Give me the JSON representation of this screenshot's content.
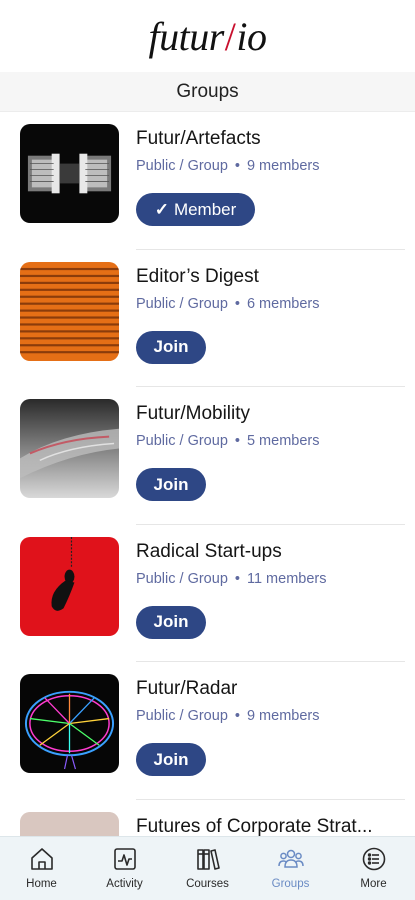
{
  "header": {
    "logo_left": "futur",
    "logo_slash": "/",
    "logo_right": "io",
    "title": "Groups"
  },
  "groups": [
    {
      "name": "Futur/Artefacts",
      "visibility": "Public / Group",
      "members": "9 members",
      "action": "Member",
      "check": "✓"
    },
    {
      "name": "Editor’s Digest",
      "visibility": "Public / Group",
      "members": "6 members",
      "action": "Join"
    },
    {
      "name": "Futur/Mobility",
      "visibility": "Public / Group",
      "members": "5 members",
      "action": "Join"
    },
    {
      "name": "Radical Start-ups",
      "visibility": "Public / Group",
      "members": "11 members",
      "action": "Join"
    },
    {
      "name": "Futur/Radar",
      "visibility": "Public / Group",
      "members": "9 members",
      "action": "Join"
    },
    {
      "name": "Futures of Corporate Strat..."
    }
  ],
  "separator": "•",
  "tabs": [
    {
      "label": "Home",
      "icon": "home-icon"
    },
    {
      "label": "Activity",
      "icon": "activity-icon"
    },
    {
      "label": "Courses",
      "icon": "courses-icon"
    },
    {
      "label": "Groups",
      "icon": "groups-icon",
      "active": true
    },
    {
      "label": "More",
      "icon": "more-icon"
    }
  ],
  "colors": {
    "button": "#2e4785",
    "meta_text": "#5f6aa0",
    "active_tab": "#6a8bc4",
    "logo_slash": "#c8102e",
    "tabbar_bg": "#eef4f7"
  }
}
